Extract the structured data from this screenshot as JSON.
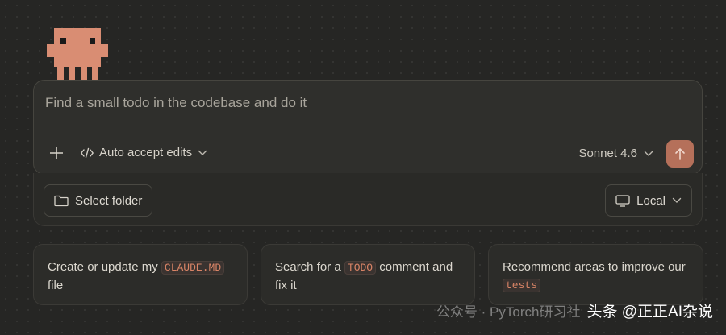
{
  "composer": {
    "placeholder": "Find a small todo in the codebase and do it",
    "mode_label": "Auto accept edits",
    "model_label": "Sonnet 4.6"
  },
  "options": {
    "select_folder_label": "Select folder",
    "environment_label": "Local"
  },
  "suggestions": [
    {
      "before": "Create or update my ",
      "code": "CLAUDE.MD",
      "after": " file"
    },
    {
      "before": "Search for a ",
      "code": "TODO",
      "after": " comment and fix it"
    },
    {
      "before": "Recommend areas to improve our ",
      "code": "tests",
      "after": ""
    }
  ],
  "watermark": {
    "first": "公众号 · PyTorch研习社",
    "second": "头条 @正正AI杂说"
  },
  "colors": {
    "background": "#262624",
    "accent": "#b5705a",
    "mascot": "#d98d73",
    "code": "#d98466"
  }
}
